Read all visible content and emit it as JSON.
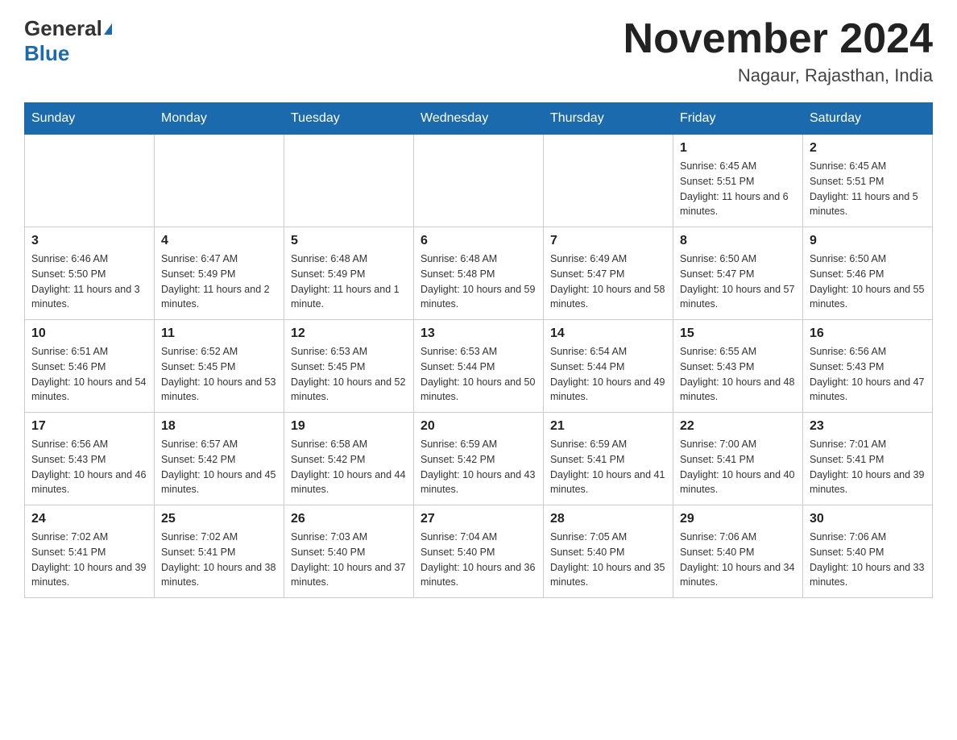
{
  "header": {
    "logo_general": "General",
    "logo_blue": "Blue",
    "month_year": "November 2024",
    "location": "Nagaur, Rajasthan, India"
  },
  "days_of_week": [
    "Sunday",
    "Monday",
    "Tuesday",
    "Wednesday",
    "Thursday",
    "Friday",
    "Saturday"
  ],
  "weeks": [
    [
      {
        "day": "",
        "info": ""
      },
      {
        "day": "",
        "info": ""
      },
      {
        "day": "",
        "info": ""
      },
      {
        "day": "",
        "info": ""
      },
      {
        "day": "",
        "info": ""
      },
      {
        "day": "1",
        "info": "Sunrise: 6:45 AM\nSunset: 5:51 PM\nDaylight: 11 hours and 6 minutes."
      },
      {
        "day": "2",
        "info": "Sunrise: 6:45 AM\nSunset: 5:51 PM\nDaylight: 11 hours and 5 minutes."
      }
    ],
    [
      {
        "day": "3",
        "info": "Sunrise: 6:46 AM\nSunset: 5:50 PM\nDaylight: 11 hours and 3 minutes."
      },
      {
        "day": "4",
        "info": "Sunrise: 6:47 AM\nSunset: 5:49 PM\nDaylight: 11 hours and 2 minutes."
      },
      {
        "day": "5",
        "info": "Sunrise: 6:48 AM\nSunset: 5:49 PM\nDaylight: 11 hours and 1 minute."
      },
      {
        "day": "6",
        "info": "Sunrise: 6:48 AM\nSunset: 5:48 PM\nDaylight: 10 hours and 59 minutes."
      },
      {
        "day": "7",
        "info": "Sunrise: 6:49 AM\nSunset: 5:47 PM\nDaylight: 10 hours and 58 minutes."
      },
      {
        "day": "8",
        "info": "Sunrise: 6:50 AM\nSunset: 5:47 PM\nDaylight: 10 hours and 57 minutes."
      },
      {
        "day": "9",
        "info": "Sunrise: 6:50 AM\nSunset: 5:46 PM\nDaylight: 10 hours and 55 minutes."
      }
    ],
    [
      {
        "day": "10",
        "info": "Sunrise: 6:51 AM\nSunset: 5:46 PM\nDaylight: 10 hours and 54 minutes."
      },
      {
        "day": "11",
        "info": "Sunrise: 6:52 AM\nSunset: 5:45 PM\nDaylight: 10 hours and 53 minutes."
      },
      {
        "day": "12",
        "info": "Sunrise: 6:53 AM\nSunset: 5:45 PM\nDaylight: 10 hours and 52 minutes."
      },
      {
        "day": "13",
        "info": "Sunrise: 6:53 AM\nSunset: 5:44 PM\nDaylight: 10 hours and 50 minutes."
      },
      {
        "day": "14",
        "info": "Sunrise: 6:54 AM\nSunset: 5:44 PM\nDaylight: 10 hours and 49 minutes."
      },
      {
        "day": "15",
        "info": "Sunrise: 6:55 AM\nSunset: 5:43 PM\nDaylight: 10 hours and 48 minutes."
      },
      {
        "day": "16",
        "info": "Sunrise: 6:56 AM\nSunset: 5:43 PM\nDaylight: 10 hours and 47 minutes."
      }
    ],
    [
      {
        "day": "17",
        "info": "Sunrise: 6:56 AM\nSunset: 5:43 PM\nDaylight: 10 hours and 46 minutes."
      },
      {
        "day": "18",
        "info": "Sunrise: 6:57 AM\nSunset: 5:42 PM\nDaylight: 10 hours and 45 minutes."
      },
      {
        "day": "19",
        "info": "Sunrise: 6:58 AM\nSunset: 5:42 PM\nDaylight: 10 hours and 44 minutes."
      },
      {
        "day": "20",
        "info": "Sunrise: 6:59 AM\nSunset: 5:42 PM\nDaylight: 10 hours and 43 minutes."
      },
      {
        "day": "21",
        "info": "Sunrise: 6:59 AM\nSunset: 5:41 PM\nDaylight: 10 hours and 41 minutes."
      },
      {
        "day": "22",
        "info": "Sunrise: 7:00 AM\nSunset: 5:41 PM\nDaylight: 10 hours and 40 minutes."
      },
      {
        "day": "23",
        "info": "Sunrise: 7:01 AM\nSunset: 5:41 PM\nDaylight: 10 hours and 39 minutes."
      }
    ],
    [
      {
        "day": "24",
        "info": "Sunrise: 7:02 AM\nSunset: 5:41 PM\nDaylight: 10 hours and 39 minutes."
      },
      {
        "day": "25",
        "info": "Sunrise: 7:02 AM\nSunset: 5:41 PM\nDaylight: 10 hours and 38 minutes."
      },
      {
        "day": "26",
        "info": "Sunrise: 7:03 AM\nSunset: 5:40 PM\nDaylight: 10 hours and 37 minutes."
      },
      {
        "day": "27",
        "info": "Sunrise: 7:04 AM\nSunset: 5:40 PM\nDaylight: 10 hours and 36 minutes."
      },
      {
        "day": "28",
        "info": "Sunrise: 7:05 AM\nSunset: 5:40 PM\nDaylight: 10 hours and 35 minutes."
      },
      {
        "day": "29",
        "info": "Sunrise: 7:06 AM\nSunset: 5:40 PM\nDaylight: 10 hours and 34 minutes."
      },
      {
        "day": "30",
        "info": "Sunrise: 7:06 AM\nSunset: 5:40 PM\nDaylight: 10 hours and 33 minutes."
      }
    ]
  ]
}
